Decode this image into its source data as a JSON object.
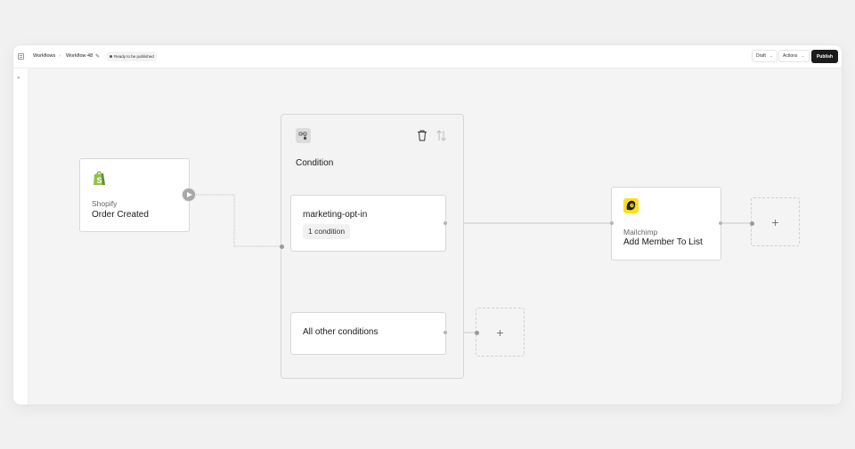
{
  "topbar": {
    "breadcrumb_root": "Workflows",
    "breadcrumb_separator": "›",
    "workflow_name": "Workflow 48",
    "status_badge": "Ready to be published",
    "draft_label": "Draft",
    "actions_label": "Actions",
    "publish_label": "Publish"
  },
  "sidebar": {
    "expand_glyph": "»"
  },
  "trigger": {
    "app": "Shopify",
    "event": "Order Created",
    "icon": "shopify-bag-icon",
    "icon_color": "#95bf47"
  },
  "condition_group": {
    "title": "Condition",
    "icon": "branch-icon",
    "branches": [
      {
        "label": "marketing-opt-in",
        "chip": "1 condition"
      },
      {
        "label": "All other conditions"
      }
    ]
  },
  "action": {
    "app": "Mailchimp",
    "event": "Add Member To List",
    "icon": "mailchimp-icon",
    "icon_color": "#ffe01b"
  },
  "add_step_glyph": "+"
}
